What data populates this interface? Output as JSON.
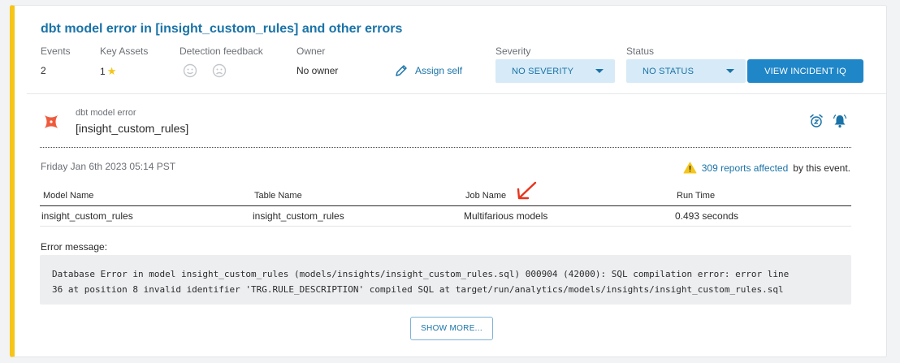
{
  "incident": {
    "title": "dbt model error in [insight_custom_rules] and other errors"
  },
  "meta": {
    "events_label": "Events",
    "events_value": "2",
    "key_assets_label": "Key Assets",
    "key_assets_value": "1",
    "detection_feedback_label": "Detection feedback",
    "owner_label": "Owner",
    "owner_value": "No owner",
    "assign_self": "Assign self",
    "severity_label": "Severity",
    "severity_value": "NO SEVERITY",
    "status_label": "Status",
    "status_value": "NO STATUS",
    "incident_button": "VIEW INCIDENT IQ"
  },
  "event": {
    "type": "dbt model error",
    "name": "[insight_custom_rules]",
    "timestamp": "Friday Jan 6th 2023 05:14 PST",
    "affected_link": "309 reports affected",
    "affected_suffix": "by this event."
  },
  "table": {
    "headers": [
      "Model Name",
      "Table Name",
      "Job Name",
      "Run Time"
    ],
    "rows": [
      [
        "insight_custom_rules",
        "insight_custom_rules",
        "Multifarious models",
        "0.493 seconds"
      ]
    ]
  },
  "error": {
    "label": "Error message:",
    "line1": "Database Error in model insight_custom_rules (models/insights/insight_custom_rules.sql) 000904 (42000): SQL compilation error: error line",
    "line2": "36 at position 8 invalid identifier 'TRG.RULE_DESCRIPTION' compiled SQL at target/run/analytics/models/insights/insight_custom_rules.sql"
  },
  "show_more": "SHOW MORE...",
  "colors": {
    "accent": "#1a73a8",
    "severity_stripe": "#f5c518",
    "dbt_logo": "#ef5a3c",
    "annotation_arrow": "#e8341c"
  }
}
